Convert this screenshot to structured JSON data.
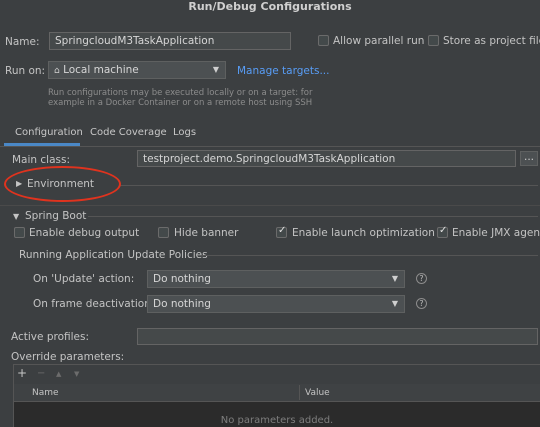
{
  "window": {
    "title": "Run/Debug Configurations"
  },
  "name_row": {
    "label": "Name:",
    "value": "SpringcloudM3TaskApplication",
    "allow_parallel_label": "Allow parallel run",
    "store_as_file_label": "Store as project file"
  },
  "run_on": {
    "label": "Run on:",
    "target": "Local machine",
    "manage_link": "Manage targets...",
    "hint_line1": "Run configurations may be executed locally or on a target: for",
    "hint_line2": "example in a Docker Container or on a remote host using SSH"
  },
  "tabs": [
    {
      "label": "Configuration",
      "selected": true
    },
    {
      "label": "Code Coverage",
      "selected": false
    },
    {
      "label": "Logs",
      "selected": false
    }
  ],
  "main_class": {
    "label": "Main class:",
    "value": "testproject.demo.SpringcloudM3TaskApplication",
    "browse_label": "..."
  },
  "environment": {
    "label": "Environment",
    "expanded": false
  },
  "spring_boot": {
    "label": "Spring Boot",
    "options": [
      {
        "label": "Enable debug output",
        "checked": false
      },
      {
        "label": "Hide banner",
        "checked": false
      },
      {
        "label": "Enable launch optimization",
        "checked": true
      },
      {
        "label": "Enable JMX agent",
        "checked": true
      }
    ],
    "policies_label": "Running Application Update Policies",
    "on_update": {
      "label": "On 'Update' action:",
      "value": "Do nothing",
      "help": "?"
    },
    "on_frame": {
      "label": "On frame deactivation:",
      "value": "Do nothing",
      "help": "?"
    }
  },
  "active_profiles": {
    "label": "Active profiles:",
    "value": ""
  },
  "override": {
    "label": "Override parameters:",
    "toolbar": {
      "add": "+",
      "remove": "−",
      "up": "▲",
      "down": "▼"
    },
    "columns": [
      "Name",
      "Value"
    ],
    "empty_text": "No parameters added."
  },
  "annotation_color": "#e0331e",
  "accent_color": "#4a88c7"
}
